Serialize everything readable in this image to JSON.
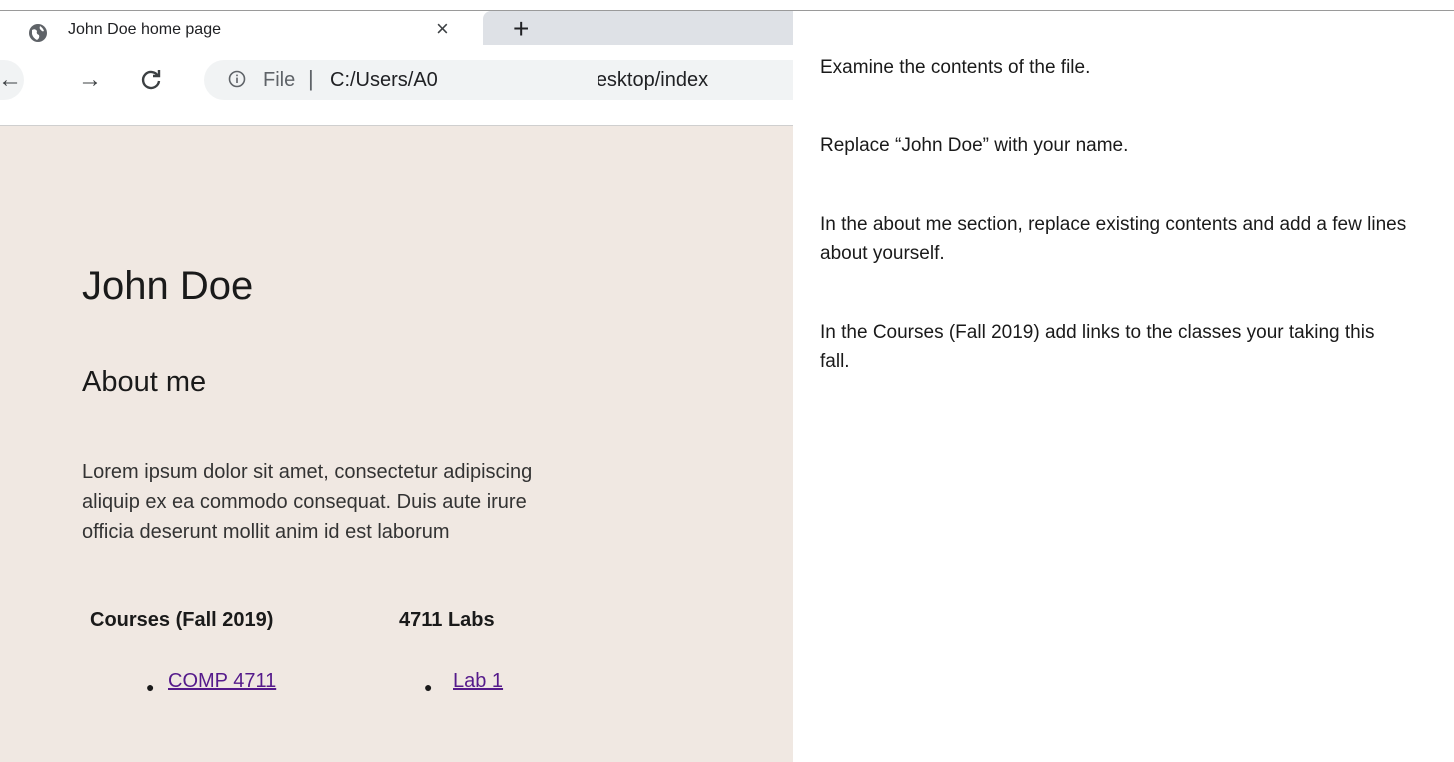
{
  "browser": {
    "tab": {
      "title": "John Doe home page",
      "close_glyph": "×",
      "icon": "globe-icon"
    },
    "new_tab_glyph": "+",
    "toolbar": {
      "back_glyph": "←",
      "forward_glyph": "→",
      "reload_glyph": "C",
      "info_icon": "info-icon",
      "url_scheme": "File",
      "url_separator": "|",
      "url_prefix": "C:/Users/A0",
      "url_suffix": "/Desktop/index"
    }
  },
  "page": {
    "background": "#f0e8e2",
    "name_heading": "John Doe",
    "about_heading": "About me",
    "about_lines": [
      "Lorem ipsum dolor sit amet, consectetur adipiscing",
      "aliquip ex ea commodo consequat. Duis aute irure",
      "officia deserunt mollit anim id est laborum"
    ],
    "courses_heading": "Courses (Fall 2019)",
    "labs_heading": "4711 Labs",
    "course_links": [
      "COMP 4711"
    ],
    "lab_links": [
      "Lab 1"
    ],
    "link_color": "#551a8b"
  },
  "instructions": [
    "Examine the contents of the file.",
    "Replace “John Doe” with your name.",
    "In the about me section, replace existing contents and add a few lines about yourself.",
    "In the Courses (Fall 2019) add links to the classes your taking this fall."
  ]
}
